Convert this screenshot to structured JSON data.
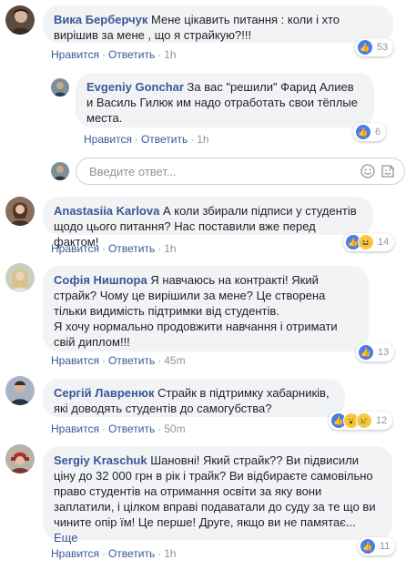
{
  "comments": [
    {
      "name": "Вика Берберчук",
      "text": "Мене цікавить питання : коли і хто вирішив за мене , що я страйкую?!!!",
      "like_label": "Нравится",
      "reply_label": "Ответить",
      "time": "1h",
      "reactions": "53"
    },
    {
      "name": "Evgeniy Gonchar",
      "text": "За вас \"решили\" Фарид Алиев и Василь Гилюк им надо отработать свои тёплые места.",
      "like_label": "Нравится",
      "reply_label": "Ответить",
      "time": "1h",
      "reactions": "6"
    },
    {
      "name": "Anastasiia Karlova",
      "text": "А коли збирали підписи у студентів щодо цього питання? Нас поставили вже перед фактом!",
      "like_label": "Нравится",
      "reply_label": "Ответить",
      "time": "1h",
      "reactions": "14"
    },
    {
      "name": "Софія Нишпора",
      "text": "Я навчаюсь на контракті! Який страйк? Чому це вирішили за мене? Це створена тільки видимість підтримки від студентів.",
      "text2": "Я хочу нормально продовжити навчання і отримати свій диплом!!!",
      "like_label": "Нравится",
      "reply_label": "Ответить",
      "time": "45m",
      "reactions": "13"
    },
    {
      "name": "Сергій Лавренюк",
      "text": "Страйк в підтримку хабарників, які доводять студентів до самогубства?",
      "like_label": "Нравится",
      "reply_label": "Ответить",
      "time": "50m",
      "reactions": "12"
    },
    {
      "name": "Sergiy Kraschuk",
      "text": "Шановні! Який страйк?? Ви підвисили ціну до 32 000 грн в рік і трайк? Ви відбираєте самовільно право студентів на отримання освіти за яку вони заплатили, і цілком вправі подаватали до суду за те що ви чините опір їм! Це перше! Друге, якщо ви не памятає...",
      "more": "Еще",
      "like_label": "Нравится",
      "reply_label": "Ответить",
      "time": "1h",
      "reactions": "11"
    }
  ],
  "reply_box": {
    "placeholder": "Введите ответ..."
  }
}
